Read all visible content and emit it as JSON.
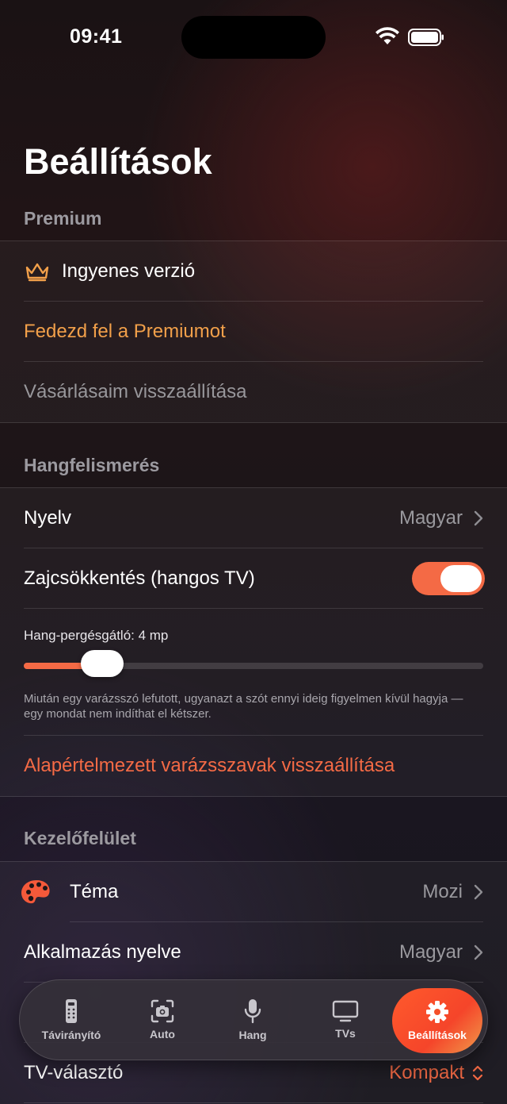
{
  "status_bar": {
    "time": "09:41"
  },
  "page": {
    "title": "Beállítások"
  },
  "premium": {
    "header": "Premium",
    "free_version": "Ingyenes verzió",
    "explore": "Fedezd fel a Premiumot",
    "restore": "Vásárlásaim visszaállítása"
  },
  "voice": {
    "header": "Hangfelismerés",
    "language_label": "Nyelv",
    "language_value": "Magyar",
    "noise_label": "Zajcsökkentés (hangos TV)",
    "noise_on": true,
    "debounce_label": "Hang-pergésgátló: 4 mp",
    "debounce_fraction": 0.17,
    "debounce_desc": "Miután egy varázsszó lefutott, ugyanazt a szót ennyi ideig figyelmen kívül hagyja — egy mondat nem indíthat el kétszer.",
    "reset_words": "Alapértelmezett varázsszavak visszaállítása"
  },
  "interface": {
    "header": "Kezelőfelület",
    "theme_label": "Téma",
    "theme_value": "Mozi",
    "app_lang_label": "Alkalmazás nyelve",
    "app_lang_value": "Magyar",
    "tv_selector_label": "TV-választó",
    "tv_selector_value": "Kompakt"
  },
  "tabbar": {
    "remote": "Távirányító",
    "auto": "Auto",
    "voice": "Hang",
    "tvs": "TVs",
    "settings": "Beállítások"
  },
  "colors": {
    "accent": "#f46a45",
    "premium": "#f2a04a"
  }
}
